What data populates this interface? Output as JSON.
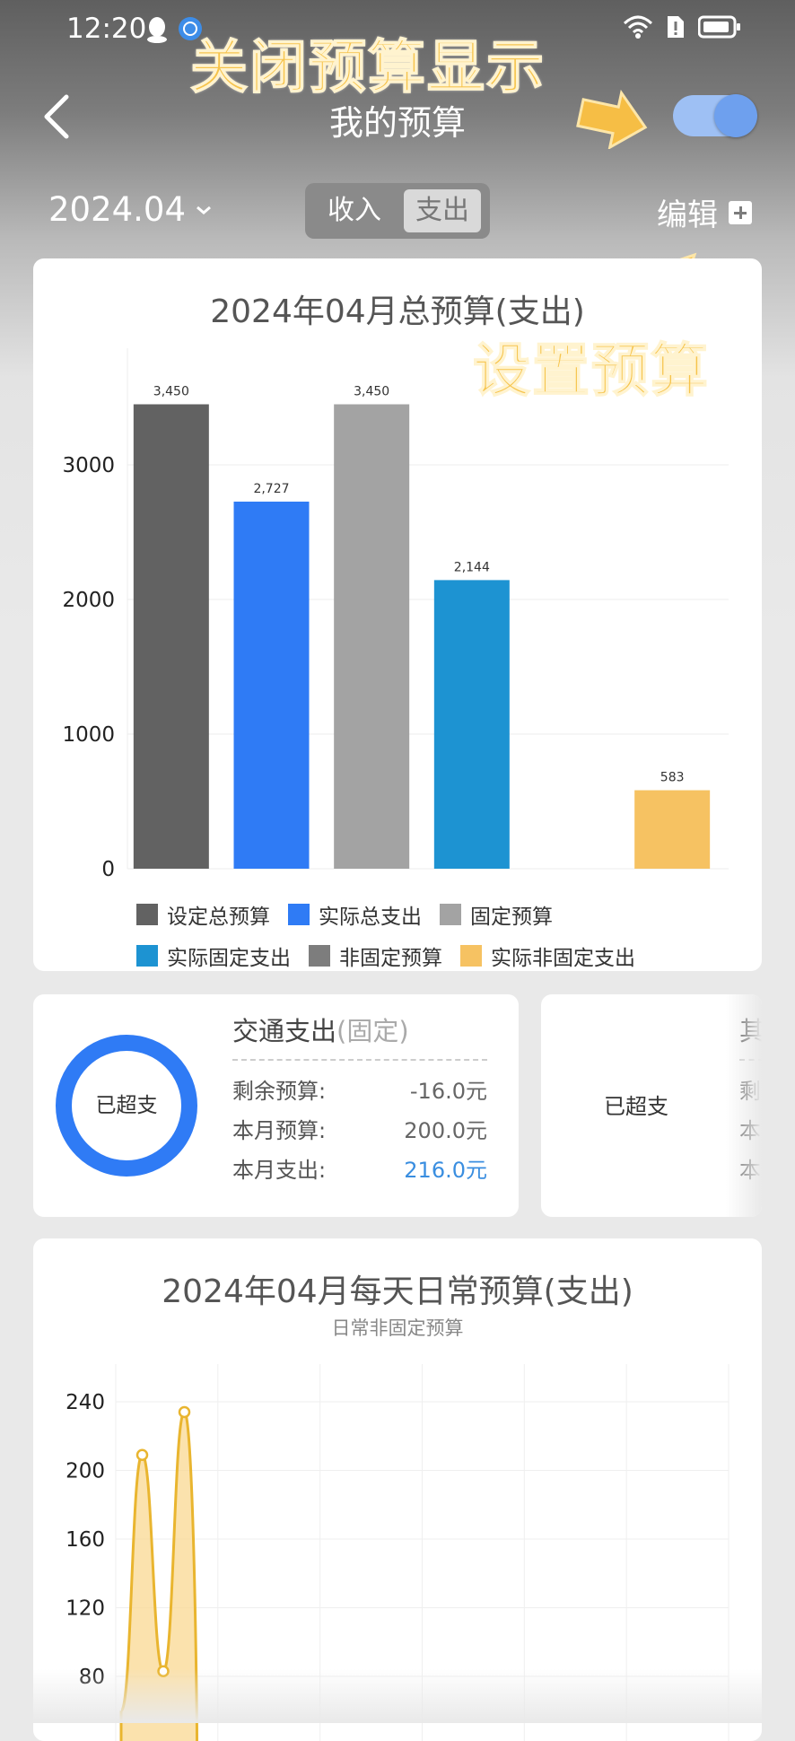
{
  "status_bar": {
    "time": "12:20"
  },
  "header": {
    "title": "我的预算",
    "toggle_on": true
  },
  "annotations": {
    "toggle_hint": "关闭预算显示",
    "edit_hint": "设置预算"
  },
  "filter": {
    "month": "2024.04",
    "segments": [
      "收入",
      "支出"
    ],
    "selected_segment": "支出",
    "edit_label": "编辑"
  },
  "budget_card": {
    "title": "2024年04月总预算(支出)",
    "legend": [
      {
        "name": "设定总预算",
        "color": "#626262"
      },
      {
        "name": "实际总支出",
        "color": "#2f7bf5"
      },
      {
        "name": "固定预算",
        "color": "#a3a3a3"
      },
      {
        "name": "实际固定支出",
        "color": "#1d93d2"
      },
      {
        "name": "非固定预算",
        "color": "#7d7d7d"
      },
      {
        "name": "实际非固定支出",
        "color": "#f6c262"
      }
    ]
  },
  "chart_data": [
    {
      "type": "bar",
      "title": "2024年04月总预算(支出)",
      "categories": [
        "设定总预算",
        "实际总支出",
        "固定预算",
        "实际固定支出",
        "非固定预算",
        "实际非固定支出"
      ],
      "values": [
        3450,
        2727,
        3450,
        2144,
        0,
        583
      ],
      "value_labels": [
        "3,450",
        "2,727",
        "3,450",
        "2,144",
        "",
        "583"
      ],
      "colors": [
        "#626262",
        "#2f7bf5",
        "#a3a3a3",
        "#1d93d2",
        "#7d7d7d",
        "#f6c262"
      ],
      "yticks": [
        0,
        1000,
        2000,
        3000
      ],
      "ylim": [
        0,
        3800
      ],
      "grid": true,
      "legend": "bottom"
    },
    {
      "type": "area",
      "title": "2024年04月每天日常预算(支出)",
      "subtitle": "日常非固定预算",
      "x": [
        1,
        2,
        3,
        4
      ],
      "y": [
        60,
        209,
        83,
        234
      ],
      "yticks": [
        80,
        120,
        160,
        200,
        240
      ],
      "ylim": [
        60,
        260
      ],
      "color": "#e9b52f",
      "grid": true
    }
  ],
  "category_cards": [
    {
      "status": "已超支",
      "name": "交通支出",
      "tag": "(固定)",
      "rows": [
        {
          "label": "剩余预算:",
          "value": "-16.0元"
        },
        {
          "label": "本月预算:",
          "value": "200.0元"
        },
        {
          "label": "本月支出:",
          "value": "216.0元"
        }
      ]
    },
    {
      "status": "已超支",
      "name_partial": "其",
      "rows_partial": [
        "剩",
        "本",
        "本"
      ]
    }
  ],
  "daily_card": {
    "title": "2024年04月每天日常预算(支出)",
    "subtitle": "日常非固定预算"
  }
}
